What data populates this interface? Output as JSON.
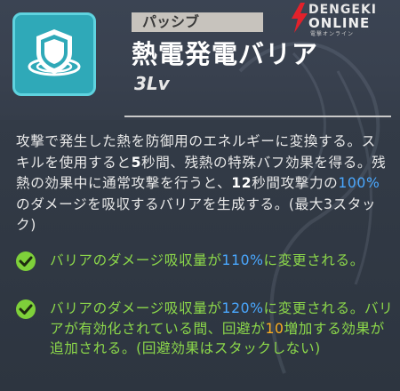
{
  "logo": {
    "line1": "DENGEKI",
    "line2": "ONLINE",
    "sub": "電撃オンライン"
  },
  "skill": {
    "icon": "shield-barrier-icon",
    "type_tag": "パッシブ",
    "name": "熱電発電バリア",
    "level": "3Lv"
  },
  "description": {
    "p1": "攻撃で発生した熱を防御用のエネルギーに変換する。スキルを使用すると",
    "p2_bold": "5",
    "p3": "秒間、残熱の特殊バフ効果を得る。残熱の効果中に通常攻撃を行うと、",
    "p4_bold": "12",
    "p5": "秒間攻撃力の",
    "p6_blue": "100%",
    "p7": "のダメージを吸収するバリアを生成する。(最大3スタック)"
  },
  "upgrades": [
    {
      "icon": "checkmark-icon",
      "t1": "バリアのダメージ吸収量が",
      "t2_blue": "110%",
      "t3": "に変更される。"
    },
    {
      "icon": "checkmark-icon",
      "t1": "バリアのダメージ吸収量が",
      "t2_blue": "120%",
      "t3": "に変更される。バリアが有効化されている間、回避が",
      "t4_orange": "10",
      "t5": "増加する効果が追加される。(回避効果はスタックしない)"
    }
  ],
  "colors": {
    "accent_blue": "#4aa8ff",
    "upgrade_green": "#8cd84a",
    "highlight_orange": "#ffb020",
    "icon_teal": "#2fa9b8"
  }
}
